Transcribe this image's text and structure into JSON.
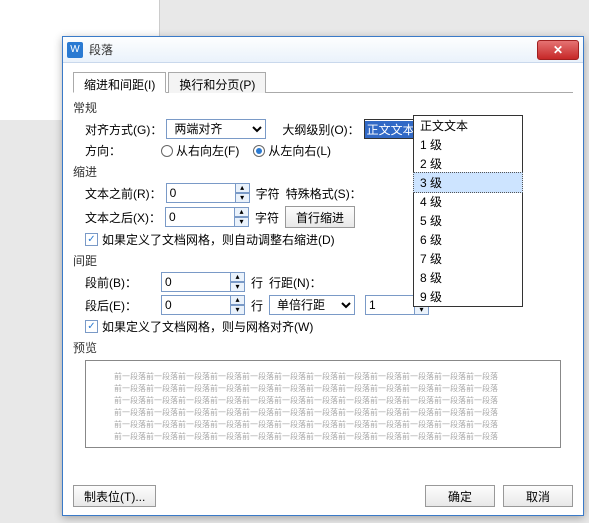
{
  "window": {
    "title": "段落"
  },
  "tabs": {
    "indent": "缩进和间距(I)",
    "page": "换行和分页(P)"
  },
  "section": {
    "general": "常规",
    "indent": "缩进",
    "spacing": "间距",
    "preview": "预览"
  },
  "labels": {
    "align": "对齐方式(G)：",
    "outline": "大纲级别(O)：",
    "direction": "方向：",
    "rtl": "从右向左(F)",
    "ltr": "从左向右(L)",
    "textBefore": "文本之前(R)：",
    "textAfter": "文本之后(X)：",
    "charsUnit": "字符",
    "specialFormat": "特殊格式(S)：",
    "firstLineIndent": "首行缩进",
    "linesUnit": "行",
    "paraBefore": "段前(B)：",
    "paraAfter": "段后(E)：",
    "lineSpacing": "行距(N)：",
    "singleSpacing": "单倍行距"
  },
  "values": {
    "align": "两端对齐",
    "outlineSelected": "正文文本",
    "textBefore": "0",
    "textAfter": "0",
    "paraBefore": "0",
    "paraAfter": "0",
    "spacingValue": "1"
  },
  "checkboxes": {
    "autoAdjust": "如果定义了文档网格，则自动调整右缩进(D)",
    "snapToGrid": "如果定义了文档网格，则与网格对齐(W)"
  },
  "dropdown": {
    "options": [
      "正文文本",
      "1 级",
      "2 级",
      "3 级",
      "4 级",
      "5 级",
      "6 级",
      "7 级",
      "8 级",
      "9 级"
    ],
    "selectedIndex": 3
  },
  "buttons": {
    "tabstops": "制表位(T)...",
    "ok": "确定",
    "cancel": "取消"
  },
  "preview": {
    "line": "前一段落前一段落前一段落前一段落前一段落前一段落前一段落前一段落前一段落前一段落前一段落前一段落"
  }
}
